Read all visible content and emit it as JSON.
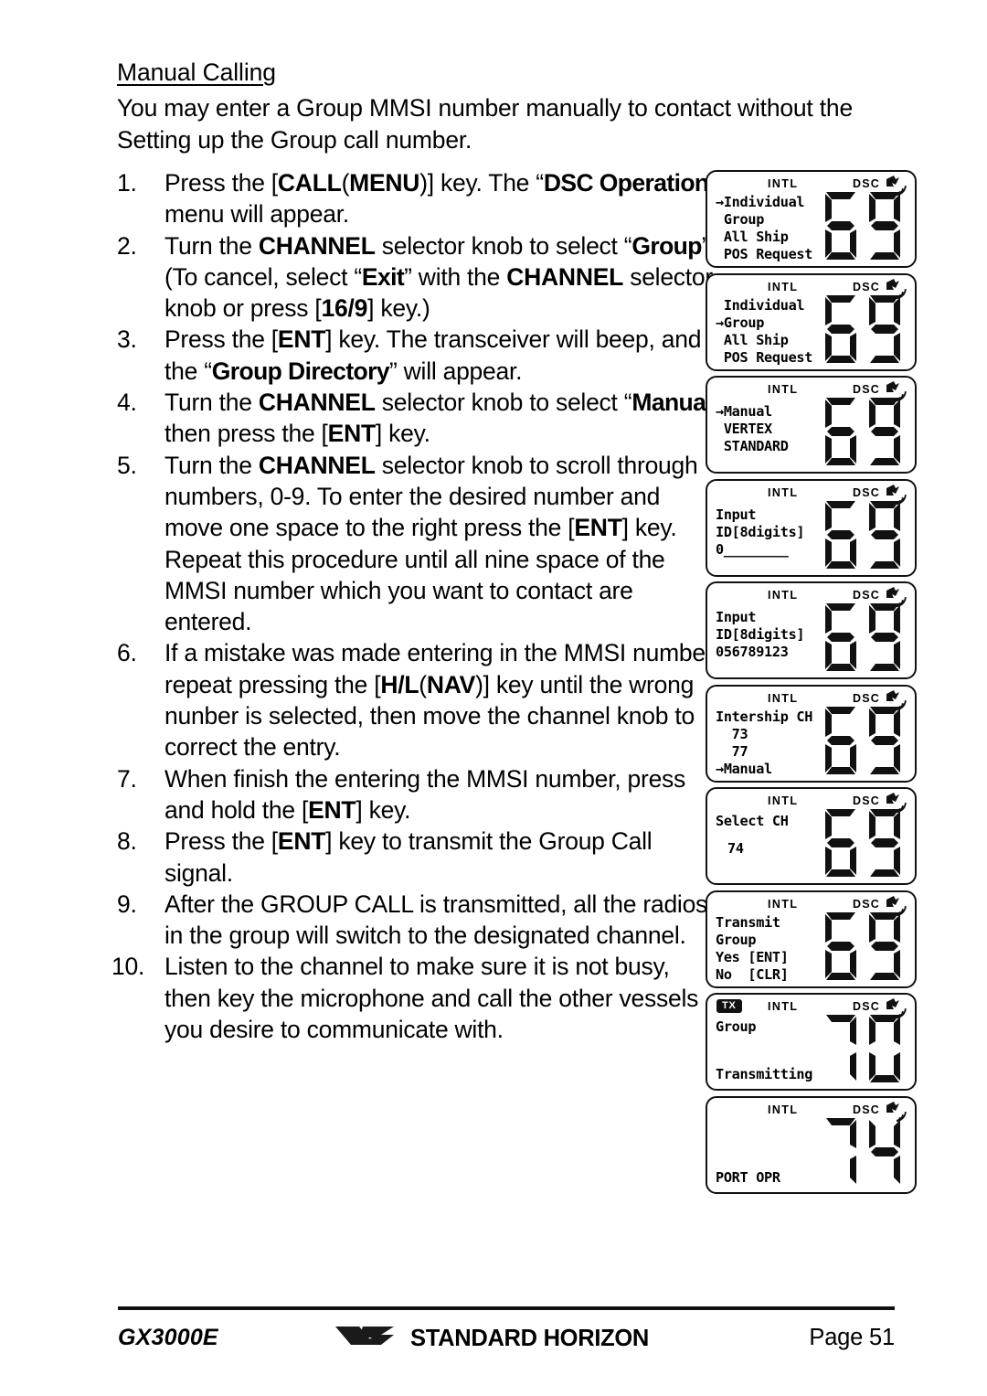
{
  "document": {
    "section_title": "Manual Calling",
    "intro": "You may enter a Group MMSI number manually to contact without the Setting up the Group call number."
  },
  "steps": [
    {
      "num": "1.",
      "parts": [
        {
          "t": "Press the [",
          "s": "plain"
        },
        {
          "t": "CALL",
          "s": "bold"
        },
        {
          "t": "(",
          "s": "plain"
        },
        {
          "t": "MENU",
          "s": "bold"
        },
        {
          "t": ")] key. The “",
          "s": "plain"
        },
        {
          "t": "DSC Operation",
          "s": "disp"
        },
        {
          "t": "” menu will appear.",
          "s": "plain"
        }
      ]
    },
    {
      "num": "2.",
      "parts": [
        {
          "t": "Turn the ",
          "s": "plain"
        },
        {
          "t": "CHANNEL",
          "s": "bold"
        },
        {
          "t": " selector knob to select “",
          "s": "plain"
        },
        {
          "t": "Group",
          "s": "disp"
        },
        {
          "t": "” (To cancel, select “",
          "s": "plain"
        },
        {
          "t": "Exit",
          "s": "disp"
        },
        {
          "t": "” with the ",
          "s": "plain"
        },
        {
          "t": "CHANNEL",
          "s": "bold"
        },
        {
          "t": " selector knob or press [",
          "s": "plain"
        },
        {
          "t": "16/9",
          "s": "bold"
        },
        {
          "t": "] key.)",
          "s": "plain"
        }
      ]
    },
    {
      "num": "3.",
      "parts": [
        {
          "t": "Press the [",
          "s": "plain"
        },
        {
          "t": "ENT",
          "s": "bold"
        },
        {
          "t": "] key. The transceiver will beep, and the “",
          "s": "plain"
        },
        {
          "t": "Group Directory",
          "s": "disp"
        },
        {
          "t": "” will appear.",
          "s": "plain"
        }
      ]
    },
    {
      "num": "4.",
      "parts": [
        {
          "t": "Turn the ",
          "s": "plain"
        },
        {
          "t": "CHANNEL",
          "s": "bold"
        },
        {
          "t": " selector knob to select “",
          "s": "plain"
        },
        {
          "t": "Manual",
          "s": "disp"
        },
        {
          "t": "” then press the [",
          "s": "plain"
        },
        {
          "t": "ENT",
          "s": "bold"
        },
        {
          "t": "] key.",
          "s": "plain"
        }
      ]
    },
    {
      "num": "5.",
      "parts": [
        {
          "t": "Turn the ",
          "s": "plain"
        },
        {
          "t": "CHANNEL",
          "s": "bold"
        },
        {
          "t": " selector knob to scroll through numbers, 0-9. To enter the desired number and move one space to the right press the [",
          "s": "plain"
        },
        {
          "t": "ENT",
          "s": "bold"
        },
        {
          "t": "] key. Repeat this procedure until all nine space of the MMSI number which you want to contact are entered.",
          "s": "plain"
        }
      ]
    },
    {
      "num": "6.",
      "parts": [
        {
          "t": "If a mistake was made entering in the MMSI number repeat pressing the [",
          "s": "plain"
        },
        {
          "t": "H/L",
          "s": "bold"
        },
        {
          "t": "(",
          "s": "plain"
        },
        {
          "t": "NAV",
          "s": "bold"
        },
        {
          "t": ")] key until the wrong nunber is selected, then move the channel knob to correct the entry.",
          "s": "plain"
        }
      ]
    },
    {
      "num": "7.",
      "parts": [
        {
          "t": "When finish the entering the MMSI number, press and hold the [",
          "s": "plain"
        },
        {
          "t": "ENT",
          "s": "bold"
        },
        {
          "t": "] key.",
          "s": "plain"
        }
      ]
    },
    {
      "num": "8.",
      "parts": [
        {
          "t": "Press the [",
          "s": "plain"
        },
        {
          "t": "ENT",
          "s": "bold"
        },
        {
          "t": "] key to transmit the Group Call signal.",
          "s": "plain"
        }
      ]
    },
    {
      "num": "9.",
      "parts": [
        {
          "t": "After the GROUP CALL is transmitted, all the radios in the group will switch to the designated channel.",
          "s": "plain"
        }
      ]
    },
    {
      "num": "10.",
      "parts": [
        {
          "t": "Listen to the channel to make sure it is not busy, then key the microphone and call the other vessels you desire to communicate with.",
          "s": "plain"
        }
      ]
    }
  ],
  "lcd_panels": [
    {
      "id": "dsc-operation-individual",
      "intl": "INTL",
      "dsc": "DSC",
      "tx": null,
      "channel": "69",
      "lines": [
        "→Individual",
        " Group",
        " All Ship",
        " POS Request"
      ]
    },
    {
      "id": "dsc-operation-group",
      "intl": "INTL",
      "dsc": "DSC",
      "tx": null,
      "channel": "69",
      "lines": [
        " Individual",
        "→Group",
        " All Ship",
        " POS Request"
      ]
    },
    {
      "id": "group-directory-manual",
      "intl": "INTL",
      "dsc": "DSC",
      "tx": null,
      "channel": "69",
      "lines": [
        "→Manual",
        " VERTEX",
        " STANDARD"
      ]
    },
    {
      "id": "input-id-empty",
      "intl": "INTL",
      "dsc": "DSC",
      "tx": null,
      "channel": "69",
      "lines": [
        "Input",
        "ID[8digits]",
        "0________"
      ]
    },
    {
      "id": "input-id-filled",
      "intl": "INTL",
      "dsc": "DSC",
      "tx": null,
      "channel": "69",
      "lines": [
        "Input",
        "ID[8digits]",
        "056789123"
      ]
    },
    {
      "id": "intership-channel",
      "intl": "INTL",
      "dsc": "DSC",
      "tx": null,
      "channel": "69",
      "lines": [
        "Intership CH",
        "  73",
        "  77",
        "→Manual"
      ]
    },
    {
      "id": "select-channel",
      "intl": "INTL",
      "dsc": "DSC",
      "tx": null,
      "channel": "69",
      "top_label": "Select CH",
      "mid_label": "74"
    },
    {
      "id": "transmit-confirm",
      "intl": "INTL",
      "dsc": "DSC",
      "tx": null,
      "channel": "69",
      "lines": [
        "Transmit",
        "Group",
        "Yes [ENT]",
        "No  [CLR]"
      ]
    },
    {
      "id": "group-transmitting",
      "intl": "INTL",
      "dsc": "DSC",
      "tx": "TX",
      "channel": "70",
      "top_label": "Group",
      "bottom_label": "Transmitting"
    },
    {
      "id": "port-opr",
      "intl": "INTL",
      "dsc": "DSC",
      "tx": null,
      "channel": "74",
      "bottom_label": "PORT OPR"
    }
  ],
  "footer": {
    "model": "GX3000E",
    "brand": "STANDARD HORIZON",
    "page": "Page 51"
  }
}
